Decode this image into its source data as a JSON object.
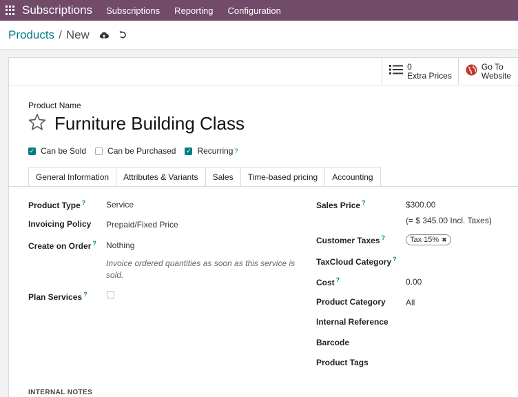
{
  "navbar": {
    "app_name": "Subscriptions",
    "menu": [
      "Subscriptions",
      "Reporting",
      "Configuration"
    ]
  },
  "breadcrumb": {
    "parent": "Products",
    "separator": "/",
    "current": "New"
  },
  "icons": {
    "save": "cloud-upload-icon",
    "discard": "undo-icon",
    "extra_prices": "list-icon",
    "website": "globe-icon",
    "favorite": "star-icon"
  },
  "smart_buttons": {
    "extra_prices": {
      "count": "0",
      "label": "Extra Prices"
    },
    "website": {
      "line1": "Go To",
      "line2": "Website"
    }
  },
  "form": {
    "product_name_label": "Product Name",
    "product_name": "Furniture Building Class",
    "checkboxes": [
      {
        "label": "Can be Sold",
        "checked": true
      },
      {
        "label": "Can be Purchased",
        "checked": false
      },
      {
        "label": "Recurring",
        "checked": true
      }
    ],
    "help_marker": "?"
  },
  "tabs": [
    "General Information",
    "Attributes & Variants",
    "Sales",
    "Time-based pricing",
    "Accounting"
  ],
  "left_fields": {
    "product_type": {
      "label": "Product Type",
      "value": "Service"
    },
    "invoicing_policy": {
      "label": "Invoicing Policy",
      "value": "Prepaid/Fixed Price"
    },
    "create_on_order": {
      "label": "Create on Order",
      "value": "Nothing"
    },
    "invoice_note": "Invoice ordered quantities as soon as this service is sold.",
    "plan_services": {
      "label": "Plan Services",
      "checked": false
    }
  },
  "right_fields": {
    "sales_price": {
      "label": "Sales Price",
      "value": "$300.00",
      "incl_taxes": "(= $ 345.00 Incl. Taxes)"
    },
    "customer_taxes": {
      "label": "Customer Taxes",
      "tag": "Tax 15%"
    },
    "taxcloud_category": {
      "label": "TaxCloud Category"
    },
    "cost": {
      "label": "Cost",
      "value": "0.00"
    },
    "product_category": {
      "label": "Product Category",
      "value": "All"
    },
    "internal_reference": {
      "label": "Internal Reference"
    },
    "barcode": {
      "label": "Barcode"
    },
    "product_tags": {
      "label": "Product Tags"
    }
  },
  "internal_notes_label": "INTERNAL NOTES",
  "colors": {
    "brand": "#714b67",
    "accent": "#017e84"
  }
}
